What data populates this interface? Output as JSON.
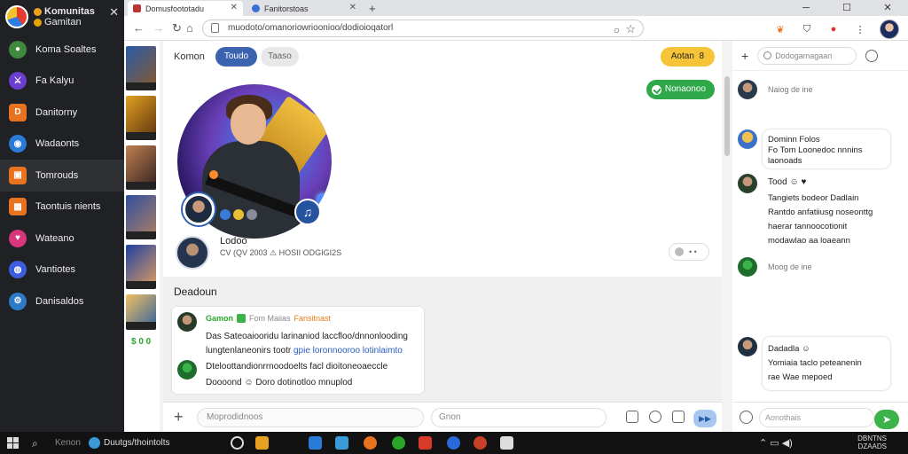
{
  "sidebar": {
    "title_line1": "Komunitas",
    "title_line2": "Gamitan",
    "items": [
      {
        "label": "Koma Soaltes",
        "color": "#3d8a3d"
      },
      {
        "label": "Fa Kalyu",
        "color": "#6a3fd0"
      },
      {
        "label": "Danitorny",
        "color": "#e8731f"
      },
      {
        "label": "Wadaonts",
        "color": "#2a7ad8"
      },
      {
        "label": "Tomrouds",
        "color": "#e8731f"
      },
      {
        "label": "Taontuis nients",
        "color": "#e8731f"
      },
      {
        "label": "Wateano",
        "color": "#d8357a"
      },
      {
        "label": "Vantiotes",
        "color": "#3d5ee0"
      },
      {
        "label": "Danisaldos",
        "color": "#2d7ac8"
      }
    ]
  },
  "thumbs": {
    "price": "$ 0 0"
  },
  "browser": {
    "tabs": [
      {
        "label": "Domusfoototadu"
      },
      {
        "label": "Fanitorstoas"
      }
    ],
    "url": "muodoto/omanoriowrioonioo/dodioioqatorl"
  },
  "main": {
    "username": "Komon",
    "filter_active": "Toudo",
    "filter_inactive": "Taaso",
    "action_button": "Aotan",
    "action_symbol": "8",
    "green_button": "Nonaonoo",
    "profile_name": "Lodoo",
    "profile_meta": "CV (QV 2003 ⚠ HOSII ODGIGI2S",
    "section_title": "Deadoun",
    "comment": {
      "author": "Gamon",
      "role": "Fom Maiias",
      "tag": "Fansitnast",
      "line1": "Das Sateoaiooridu larinaniod laccfloo/dnnonlooding",
      "line2_a": "lungtenlaneonirs tootr",
      "line2_b": "gpie loronnooroo lotinlaimto",
      "line3": "Dteloottandionrrnoodoelts facl dioitoneoaeccle",
      "line4": "Doooond ☺ Doro dotinotloo mnuplod"
    },
    "composer_placeholder": "Moprodidnoos",
    "composer_search": "Gnon",
    "send_label": "▶▶"
  },
  "chat": {
    "search_placeholder": "Dodogamagaan",
    "messages": [
      {
        "time": "Naiog de ine"
      },
      {
        "text1": "Dominn Folos",
        "text2": "Fo Tom Loonedoc nnnins",
        "text3": "laonoads"
      },
      {
        "name": "Tood ☺ ♥",
        "lines": [
          "Tangiets bodeor Dadlain",
          "Rantdo anfatiiusg noseonttg",
          "haerar tannoocotionit",
          "modawlao aa loaeann"
        ]
      },
      {
        "time": "Moog de ine"
      },
      {
        "name": "Dadadla ☺",
        "lines": [
          "Yomiaia taclo peteanenin",
          "rae Wae mepoed"
        ]
      }
    ],
    "input_placeholder": "Aonothais"
  },
  "taskbar": {
    "search_label": "Kenon",
    "task_label": "Duutgs/thointolts",
    "time_line1": "DBNTNS",
    "time_line2": "DZAADS"
  }
}
